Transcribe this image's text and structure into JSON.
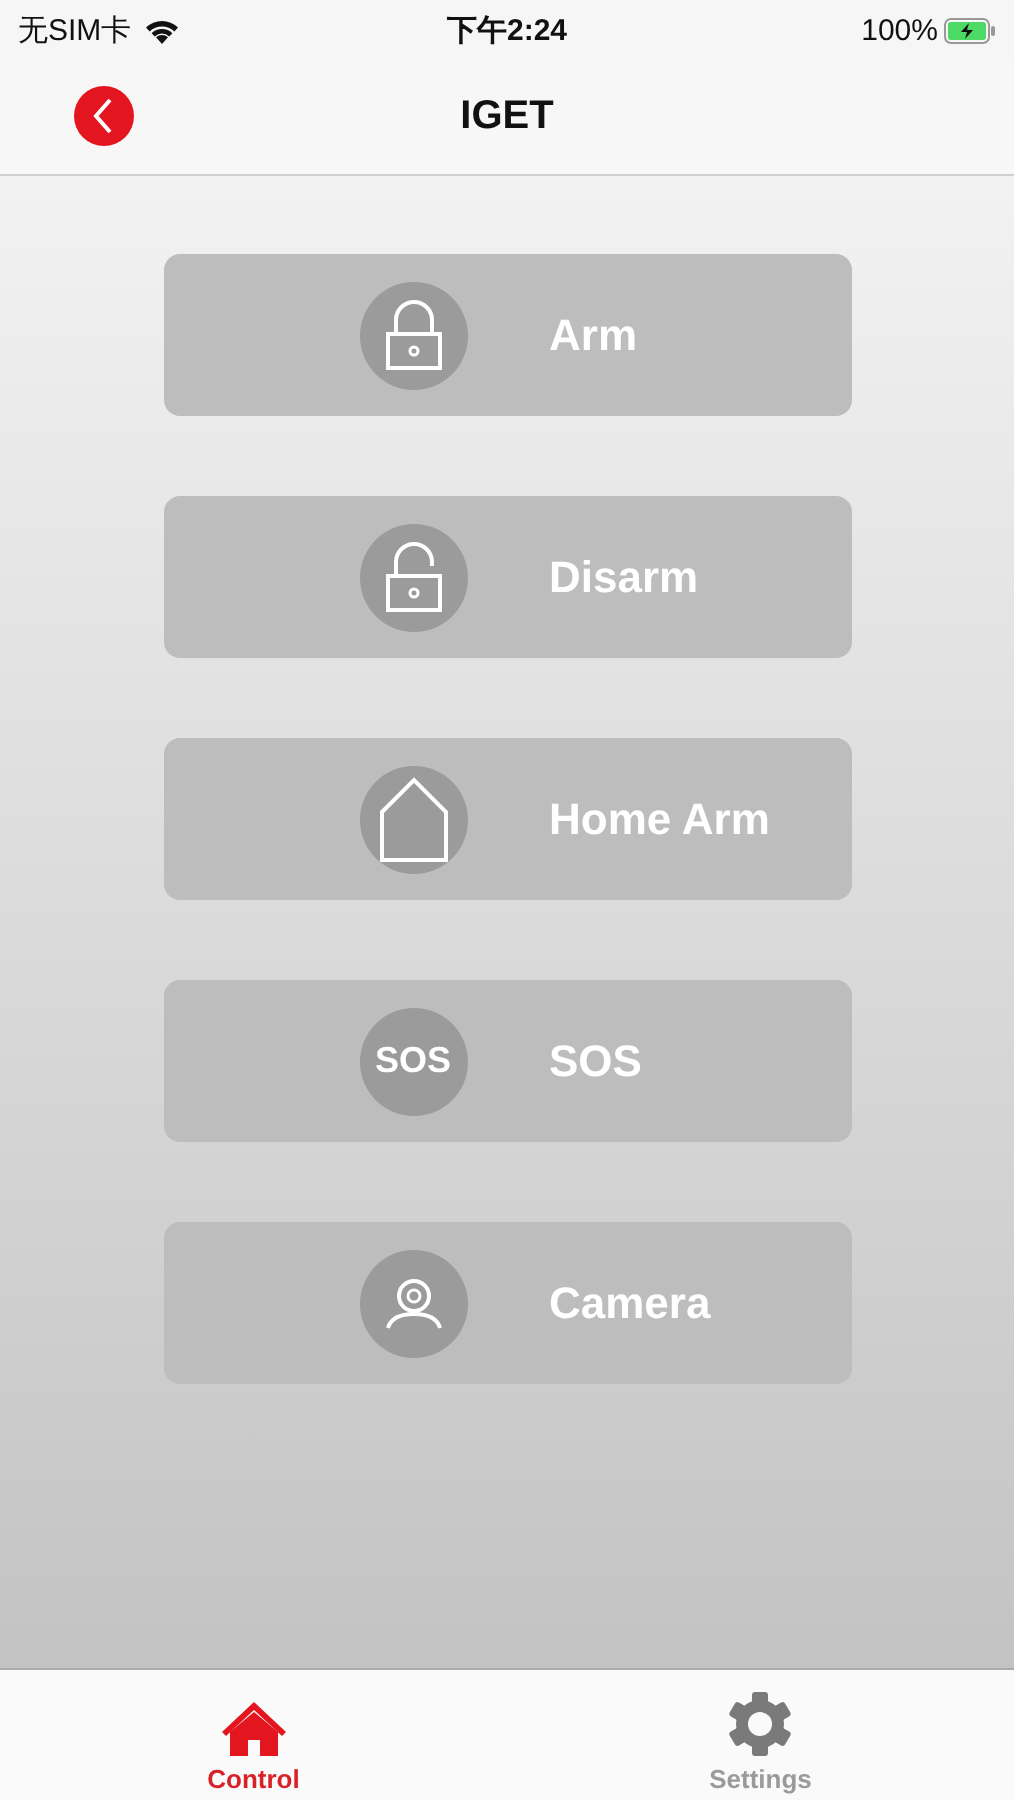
{
  "status_bar": {
    "carrier": "无SIM卡",
    "time": "下午2:24",
    "battery": "100%"
  },
  "nav": {
    "title": "IGET"
  },
  "actions": [
    {
      "kind": "lock",
      "label": "Arm"
    },
    {
      "kind": "unlock",
      "label": "Disarm"
    },
    {
      "kind": "home",
      "label": "Home Arm"
    },
    {
      "kind": "sos",
      "label": "SOS",
      "icon_text": "SOS"
    },
    {
      "kind": "camera",
      "label": "Camera"
    }
  ],
  "tabs": [
    {
      "kind": "home",
      "label": "Control",
      "selected": true
    },
    {
      "kind": "gear",
      "label": "Settings",
      "selected": false
    }
  ]
}
